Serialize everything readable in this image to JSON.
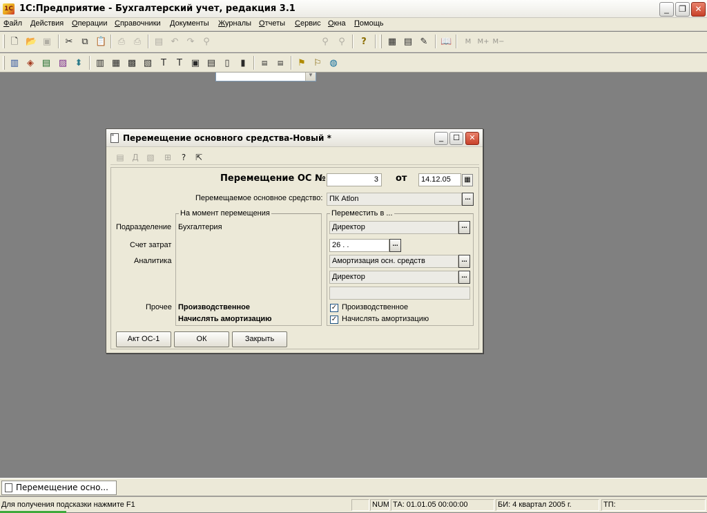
{
  "window": {
    "title": "1С:Предприятие - Бухгалтерский учет, редакция 3.1",
    "app_icon_text": "1С",
    "controls": [
      "_",
      "❐",
      "✕"
    ]
  },
  "menu": [
    "Файл",
    "Действия",
    "Операции",
    "Справочники",
    "Документы",
    "Журналы",
    "Отчеты",
    "Сервис",
    "Окна",
    "Помощь"
  ],
  "toolbar": {
    "row1_icons": [
      "new-icon",
      "open-icon",
      "save-icon",
      "cut-icon",
      "copy-icon",
      "paste-icon",
      "print-icon",
      "print-preview-icon",
      "properties-icon",
      "undo-icon",
      "redo-icon",
      "find-icon",
      "search-next-icon",
      "search-prev-icon",
      "help-icon",
      "calculator-icon",
      "calendar-icon",
      "text-editor-icon",
      "book-icon"
    ],
    "memory_labels": [
      "M",
      "M+",
      "M−"
    ],
    "combo_value": ""
  },
  "dialog": {
    "title": "Перемещение основного средства-Новый *",
    "controls": [
      "_",
      "☐",
      "✕"
    ],
    "header_label": "Перемещение ОС №",
    "number": "3",
    "date_label": "от",
    "date": "14.12.05",
    "asset_label": "Перемещаемое основное средство:",
    "asset_value": "ПК Atlon",
    "group_from": "На момент перемещения",
    "group_to": "Переместить в ...",
    "row_labels": {
      "department": "Подразделение",
      "cost_account": "Счет затрат",
      "analytics": "Аналитика",
      "other": "Прочее"
    },
    "from": {
      "department": "Бухгалтерия",
      "other1": "Производственное",
      "other2": "Начислять амортизацию"
    },
    "to": {
      "department": "Директор",
      "cost_account": "26 .  .",
      "analytics1": "Амортизация осн. средств",
      "analytics2": "Директор",
      "analytics3": "",
      "check1_label": "Производственное",
      "check1_checked": true,
      "check2_label": "Начислять амортизацию",
      "check2_checked": true
    },
    "buttons": {
      "act": "Акт ОС-1",
      "ok": "ОК",
      "close": "Закрыть"
    },
    "select_button": "..."
  },
  "taskbar": {
    "item": "Перемещение осно..."
  },
  "status": {
    "hint": "Для получения подсказки нажмите F1",
    "num": "NUM",
    "ta": "ТА: 01.01.05  00:00:00",
    "bi": "БИ: 4 квартал 2005 г.",
    "tp": "ТП:"
  },
  "colors": {
    "workspace": "#808080",
    "chrome": "#ece9d8",
    "close_button": "#c8412a",
    "progress": "#3fa93b"
  }
}
